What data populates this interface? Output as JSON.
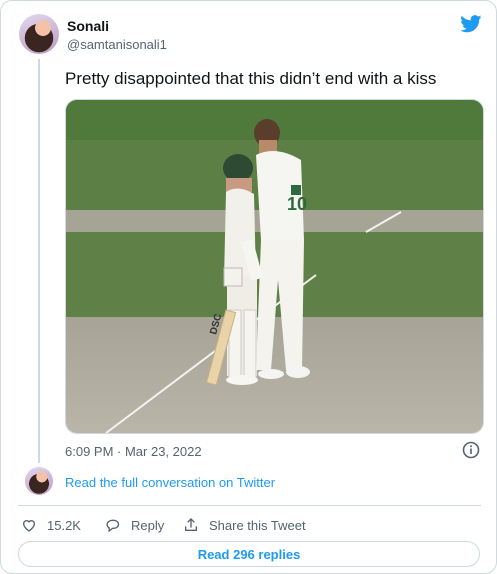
{
  "author": {
    "display_name": "Sonali",
    "handle": "@samtanisonali1"
  },
  "tweet": {
    "text": "Pretty disappointed that this didn’t end with a kiss",
    "timestamp": "6:09 PM · Mar 23, 2022"
  },
  "conversation_link": "Read the full conversation on Twitter",
  "actions": {
    "likes": "15.2K",
    "reply_label": "Reply",
    "share_label": "Share this Tweet"
  },
  "replies_button": "Read 296 replies",
  "media": {
    "jersey_number": "10",
    "bat_logo": "DSC"
  },
  "icons": [
    "twitter-bird-icon",
    "info-icon",
    "heart-icon",
    "reply-icon",
    "share-icon"
  ],
  "colors": {
    "accent": "#1d9bf0",
    "secondary_text": "#536471",
    "border": "#cfd9de"
  }
}
